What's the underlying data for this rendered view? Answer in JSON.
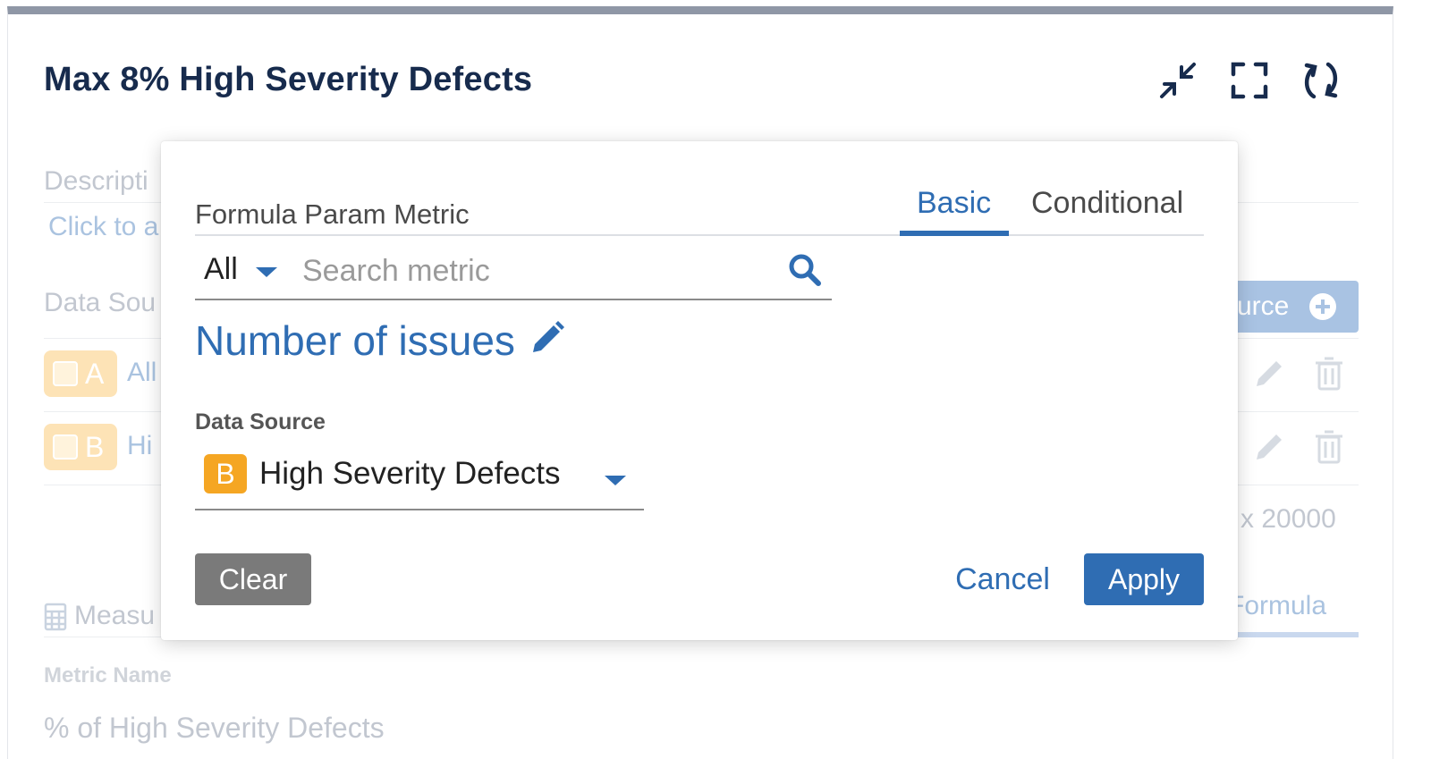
{
  "panel": {
    "title": "Max 8% High Severity Defects"
  },
  "background": {
    "description_label": "Descripti",
    "description_placeholder": "Click to a",
    "data_sources_label": "Data Sou",
    "row_a": {
      "letter": "A",
      "label": "All"
    },
    "row_b": {
      "letter": "B",
      "label": "Hi"
    },
    "add_source_label": "urce",
    "max_text": "x 20000",
    "measures_label": "Measu",
    "formula_tab": "Formula",
    "metric_name_label": "Metric Name",
    "metric_name_value": "% of High Severity Defects"
  },
  "modal": {
    "label": "Formula Param Metric",
    "tabs": [
      {
        "label": "Basic",
        "active": true
      },
      {
        "label": "Conditional",
        "active": false
      }
    ],
    "filter": {
      "selected": "All"
    },
    "search": {
      "placeholder": "Search metric",
      "value": ""
    },
    "metric_name": "Number of issues",
    "data_source": {
      "label": "Data Source",
      "badge_letter": "B",
      "value": "High Severity Defects"
    },
    "buttons": {
      "clear": "Clear",
      "cancel": "Cancel",
      "apply": "Apply"
    }
  },
  "colors": {
    "accent": "#2f6db3",
    "title": "#172b4d",
    "badge_orange": "#f5a623",
    "clear_gray": "#7a7a7a"
  }
}
